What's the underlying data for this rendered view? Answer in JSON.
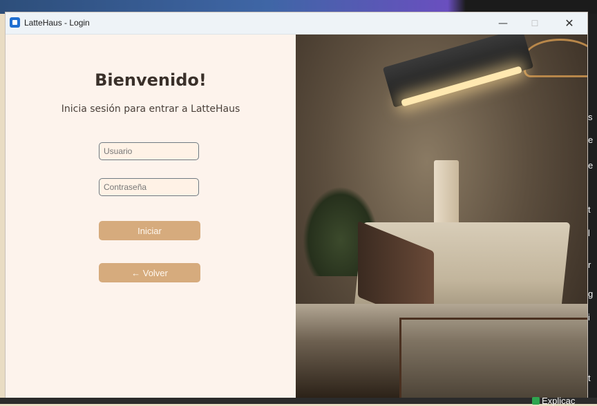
{
  "window": {
    "title": "LatteHaus - Login",
    "controls": {
      "minimize": "—",
      "maximize": "☐",
      "close": "✕"
    }
  },
  "login": {
    "heading": "Bienvenido!",
    "subheading": "Inicia sesión para entrar a LatteHaus",
    "username_placeholder": "Usuario",
    "username_value": "",
    "password_placeholder": "Contraseña",
    "password_value": "",
    "login_label": "Iniciar",
    "back_label": "← Volver"
  },
  "background": {
    "side_text": [
      "s",
      "e",
      "e",
      "t",
      "l",
      "r",
      "g",
      "i",
      "t"
    ],
    "corner_text": "Explicac"
  },
  "colors": {
    "panel_bg": "#fdf3ec",
    "button_bg": "#d6ab7d",
    "input_bg": "#fff2e6",
    "accent_icon": "#1f6fd1"
  },
  "icons": {
    "app": "latte-haus-app-icon",
    "check": "check-icon"
  }
}
